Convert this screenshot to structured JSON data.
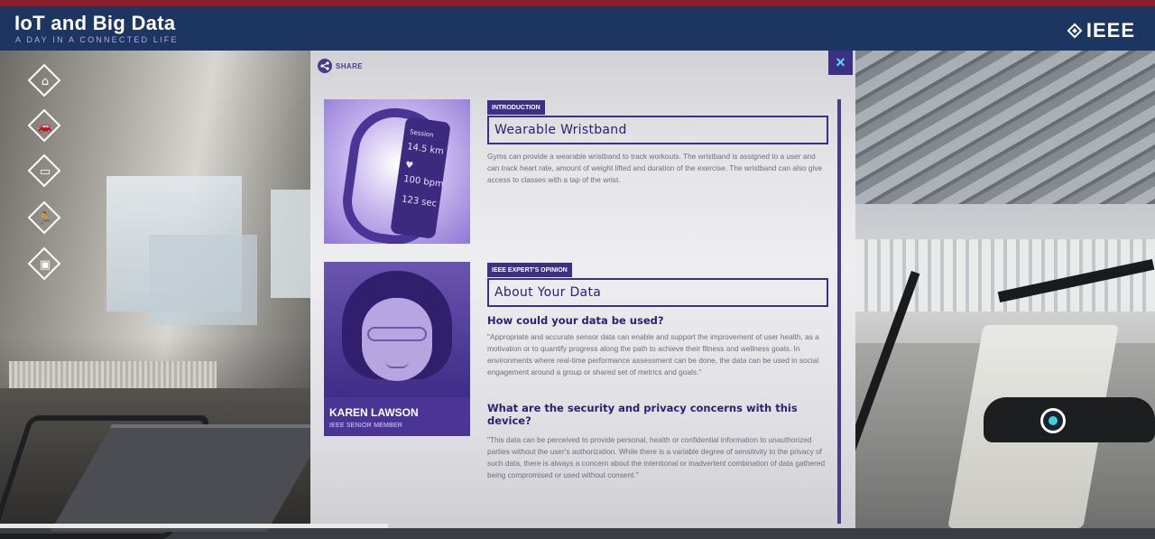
{
  "header": {
    "title": "IoT and Big Data",
    "subtitle": "A DAY IN A CONNECTED LIFE",
    "logo_text": "IEEE"
  },
  "nav": {
    "items": [
      {
        "name": "home-nav-icon",
        "glyph": "⌂"
      },
      {
        "name": "car-nav-icon",
        "glyph": "🚗"
      },
      {
        "name": "office-nav-icon",
        "glyph": "▭"
      },
      {
        "name": "gym-nav-icon",
        "glyph": "🏃"
      },
      {
        "name": "devices-nav-icon",
        "glyph": "▣"
      }
    ]
  },
  "panel": {
    "share_label": "SHARE",
    "close_label": "×",
    "intro": {
      "tag": "INTRODUCTION",
      "title": "Wearable Wristband",
      "body": "Gyms can provide a wearable wristband to track workouts. The wristband is assigned to a user and can track heart rate, amount of weight lifted and duration of the exercise. The wristband can also give access to classes with a tap of the wrist."
    },
    "device_readouts": [
      "Session",
      "14.5 km",
      "♥",
      "100 bpm",
      "123 sec"
    ],
    "expert": {
      "tag": "IEEE EXPERT'S OPINION",
      "title": "About Your Data",
      "name": "KAREN LAWSON",
      "role": "IEEE SENIOR MEMBER",
      "q1": "How could your data be used?",
      "a1": "\"Appropriate and accurate sensor data can enable and support the improvement of user health, as a motivation or to quantify progress along the path to achieve their fitness and wellness goals. In environments where real-time performance assessment can be done, the data can be used in social engagement around a group or shared set of metrics and goals.\"",
      "q2": "What are the security and privacy concerns with this device?",
      "a2": "\"This data can be perceived to provide personal, health or confidential information to unauthorized parties without the user's authorization. While there is a variable degree of sensitivity to the privacy of such data, there is always a concern about the intentional or inadvertent combination of data gathered being compromised or used without consent.\""
    }
  },
  "colors": {
    "header_bg": "#1c3561",
    "accent_purple": "#3c2f86",
    "close_x": "#5fd7ea",
    "hotspot": "#3fd0e0"
  }
}
